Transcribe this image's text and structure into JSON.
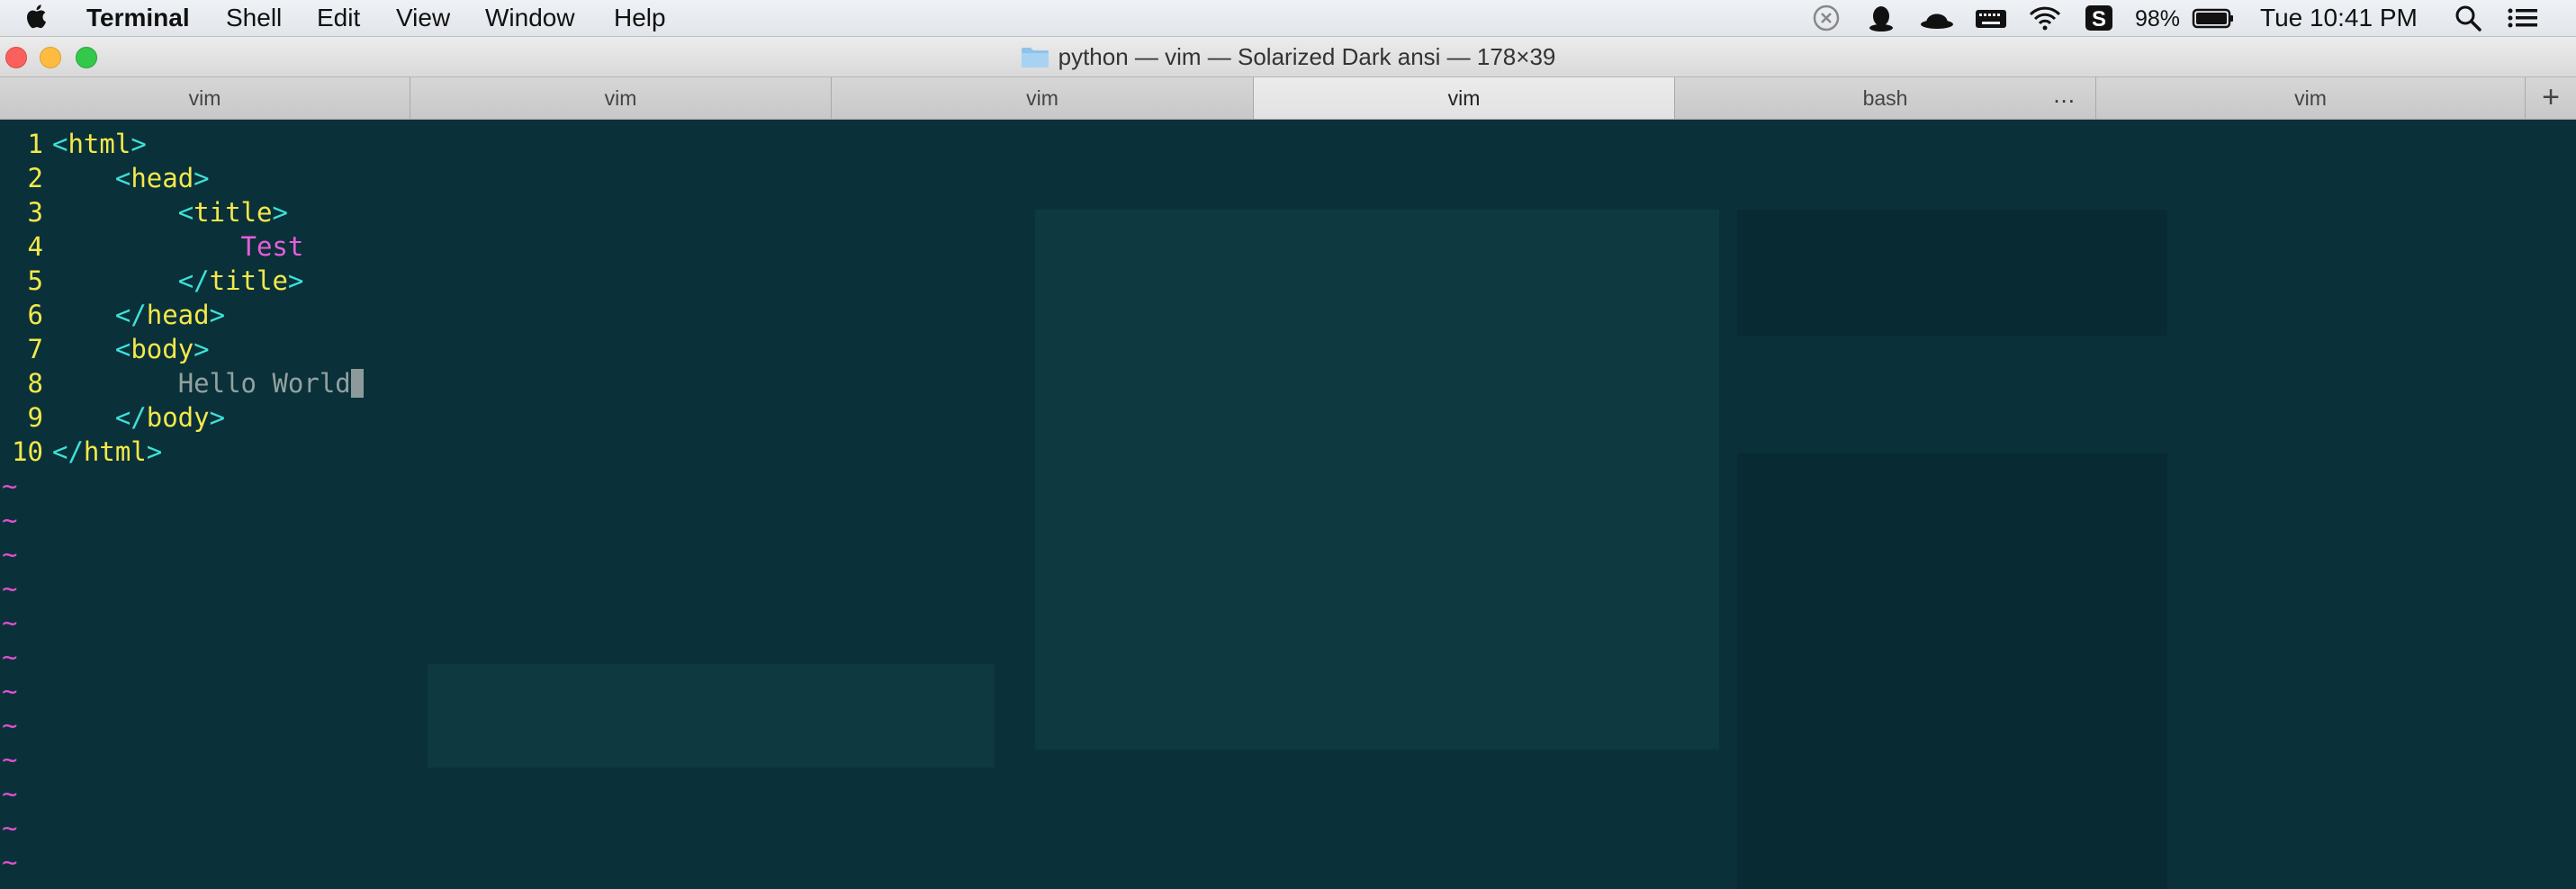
{
  "menubar": {
    "app_name": "Terminal",
    "menus": [
      "Shell",
      "Edit",
      "View",
      "Window",
      "Help"
    ],
    "battery_percent": "98%",
    "clock": "Tue 10:41 PM",
    "icons": [
      "apple-icon",
      "x-circle-icon",
      "qq-icon",
      "hat-icon",
      "keyboard-icon",
      "wifi-icon",
      "s-app-icon",
      "battery-icon",
      "search-icon",
      "list-icon"
    ]
  },
  "window": {
    "title": "python — vim — Solarized Dark ansi — 178×39"
  },
  "tabs": [
    {
      "label": "vim",
      "active": false
    },
    {
      "label": "vim",
      "active": false
    },
    {
      "label": "vim",
      "active": false
    },
    {
      "label": "vim",
      "active": true
    },
    {
      "label": "bash",
      "active": false,
      "more": "..."
    },
    {
      "label": "vim",
      "active": false
    }
  ],
  "new_tab_label": "+",
  "editor": {
    "lines": [
      {
        "num": "1",
        "indent": "",
        "open": "<",
        "tag": "html",
        "close": ">",
        "text": ""
      },
      {
        "num": "2",
        "indent": "    ",
        "open": "<",
        "tag": "head",
        "close": ">",
        "text": ""
      },
      {
        "num": "3",
        "indent": "        ",
        "open": "<",
        "tag": "title",
        "close": ">",
        "text": ""
      },
      {
        "num": "4",
        "indent": "            ",
        "open": "",
        "tag": "",
        "close": "",
        "text": "Test"
      },
      {
        "num": "5",
        "indent": "        ",
        "open": "</",
        "tag": "title",
        "close": ">",
        "text": ""
      },
      {
        "num": "6",
        "indent": "    ",
        "open": "</",
        "tag": "head",
        "close": ">",
        "text": ""
      },
      {
        "num": "7",
        "indent": "    ",
        "open": "<",
        "tag": "body",
        "close": ">",
        "text": ""
      },
      {
        "num": "8",
        "indent": "        ",
        "open": "",
        "tag": "",
        "close": "",
        "text": "Hello World",
        "plain": true,
        "cursor": true
      },
      {
        "num": "9",
        "indent": "    ",
        "open": "</",
        "tag": "body",
        "close": ">",
        "text": ""
      },
      {
        "num": "10",
        "indent": "",
        "open": "</",
        "tag": "html",
        "close": ">",
        "text": ""
      }
    ],
    "empty_line_marker": "~",
    "empty_line_count": 12
  },
  "colors": {
    "background": "#0a3139",
    "line_number": "#f5e84a",
    "tag_name": "#f5e84a",
    "tag_bracket": "#3fe0d8",
    "title_text": "#e85ddd",
    "plain_text": "#93a1a1",
    "tilde": "#e24fd0"
  }
}
